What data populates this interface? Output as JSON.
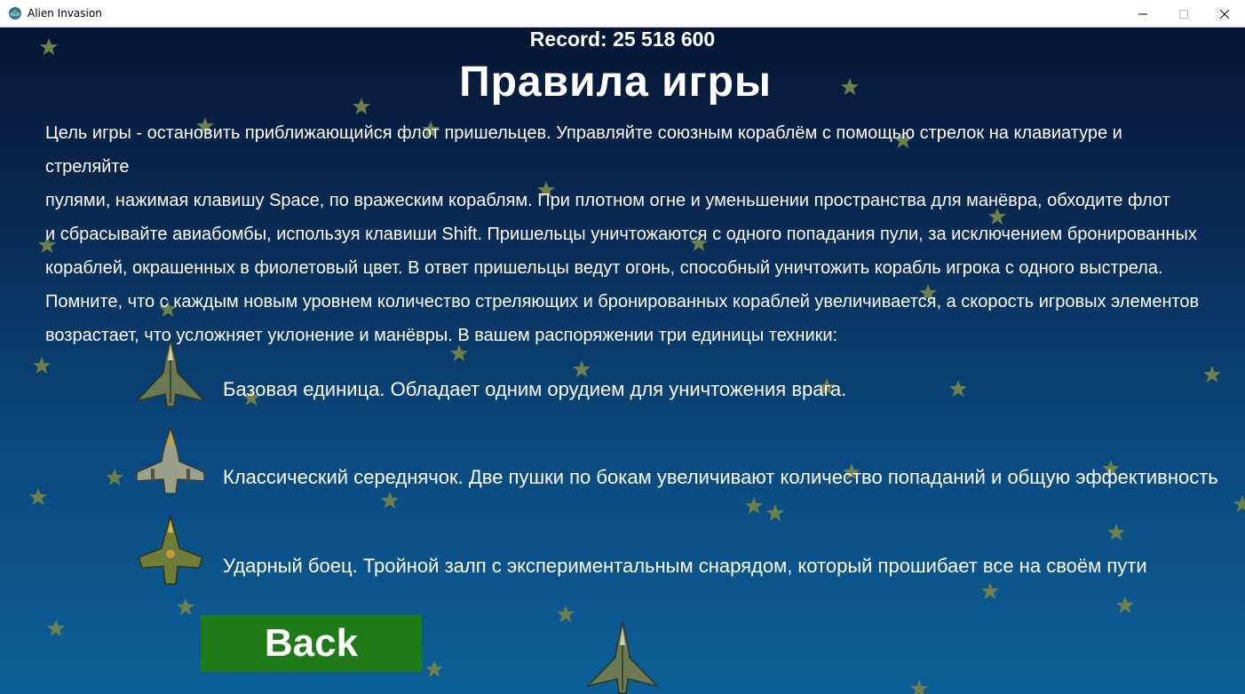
{
  "window": {
    "title": "Alien Invasion",
    "icon": "alien-ufo-icon",
    "controls": [
      "minimize-icon",
      "maximize-icon",
      "close-icon"
    ]
  },
  "game": {
    "record": "Record: 25 518 600",
    "heading": "Правила игры",
    "rules_lines": [
      "Цель игры - остановить приближающийся флот пришельцев. Управляйте союзным кораблём с помощью стрелок на клавиатуре и стреляйте",
      "пулями, нажимая клавишу Space, по вражеским кораблям. При плотном огне и уменьшении пространства для манёвра, обходите флот",
      "и сбрасывайте авиабомбы, используя клавиши Shift. Пришельцы уничтожаются с одного попадания пули, за исключением бронированных",
      "кораблей, окрашенных в фиолетовый цвет. В ответ пришельцы ведут огонь, способный уничтожить корабль игрока с одного выстрела.",
      "Помните, что с каждым новым уровнем количество стреляющих и бронированных кораблей увеличивается, а скорость игровых элементов",
      "возрастает, что усложняет уклонение и манёвры. В вашем распоряжении три единицы техники:"
    ],
    "units": [
      {
        "icon": "fighter-jet-basic-icon",
        "text": "Базовая единица. Обладает одним орудием для уничтожения врага."
      },
      {
        "icon": "fighter-jet-classic-icon",
        "text": "Классический середнячок. Две пушки по бокам увеличивают количество попаданий и общую эффективность"
      },
      {
        "icon": "fighter-jet-strike-icon",
        "text": "Ударный боец. Тройной залп с экспериментальным снарядом, который прошибает все на своём пути"
      }
    ],
    "back_label": "Back",
    "colors": {
      "background_top": "#071634",
      "background_bottom": "#0c5f98",
      "star": "#6d7f4a",
      "back_button": "#1f7a18",
      "text": "#ffffff"
    }
  }
}
